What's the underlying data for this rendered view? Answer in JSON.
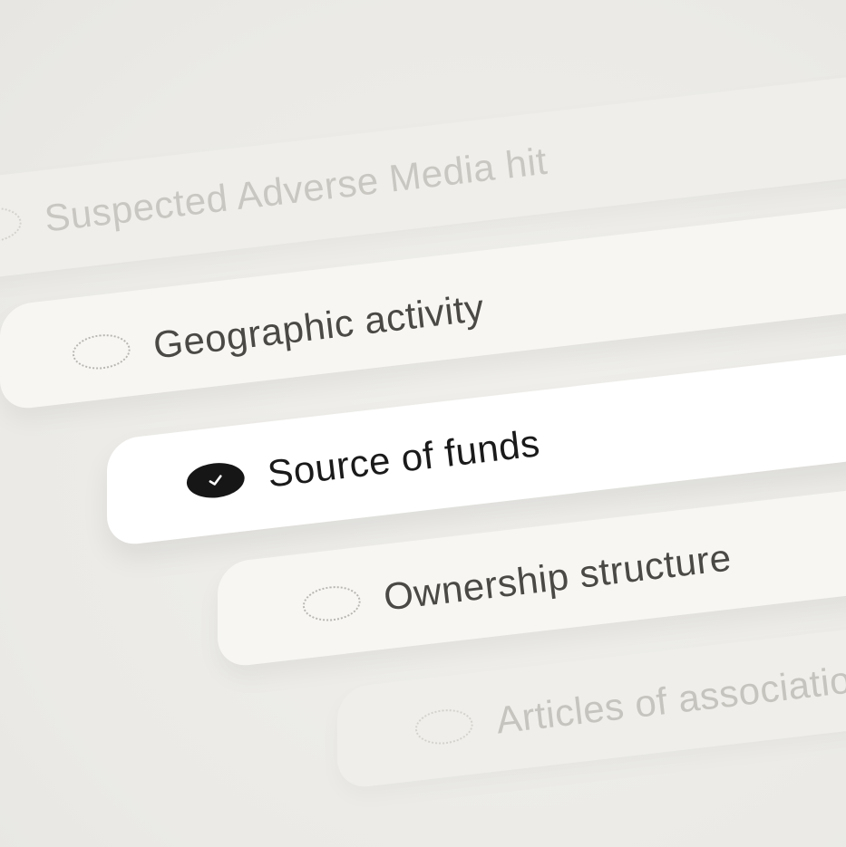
{
  "checklist": {
    "items": [
      {
        "label": "Suspected Adverse Media hit",
        "status": "pending"
      },
      {
        "label": "Geographic activity",
        "status": "pending"
      },
      {
        "label": "Source of funds",
        "status": "complete"
      },
      {
        "label": "Ownership structure",
        "status": "pending"
      },
      {
        "label": "Articles of association",
        "status": "pending"
      }
    ]
  }
}
